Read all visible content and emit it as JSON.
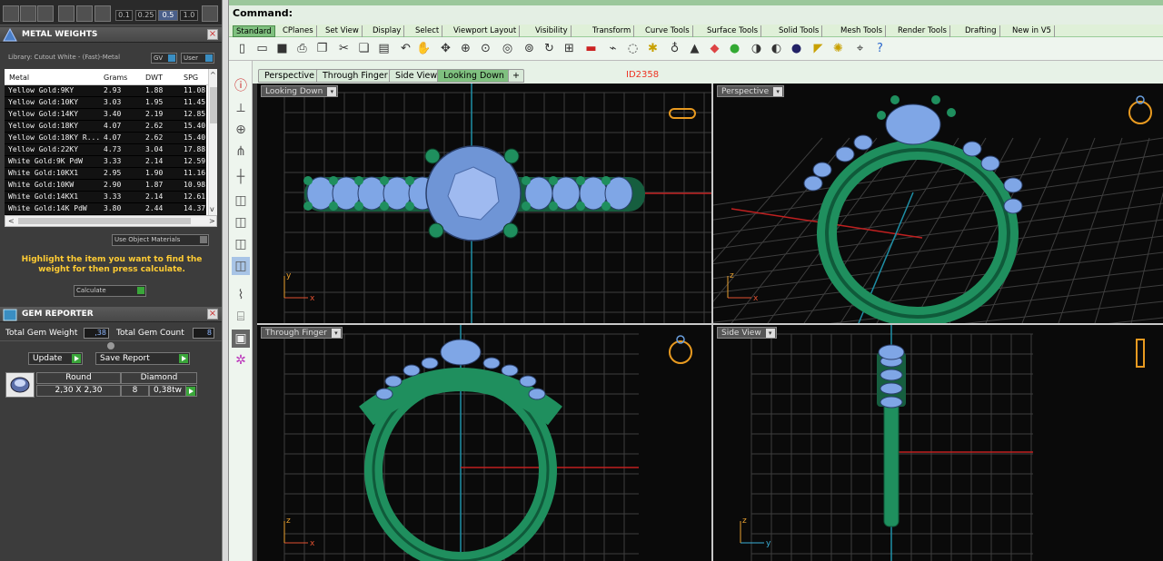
{
  "toolbar_numbers": [
    "0.1",
    "0.25",
    "0.5",
    "1.0"
  ],
  "metal_panel": {
    "title": "METAL WEIGHTS",
    "library": "Library: Cutout White - (Fast)-Metal",
    "gv_label": "GV",
    "user_label": "User",
    "columns": [
      "Metal",
      "Grams",
      "DWT",
      "SPG"
    ],
    "rows": [
      {
        "metal": "Yellow Gold:9KY",
        "grams": "2.93",
        "dwt": "1.88",
        "spg": "11.08"
      },
      {
        "metal": "Yellow Gold:10KY",
        "grams": "3.03",
        "dwt": "1.95",
        "spg": "11.45"
      },
      {
        "metal": "Yellow Gold:14KY",
        "grams": "3.40",
        "dwt": "2.19",
        "spg": "12.85"
      },
      {
        "metal": "Yellow Gold:18KY",
        "grams": "4.07",
        "dwt": "2.62",
        "spg": "15.40"
      },
      {
        "metal": "Yellow Gold:18KY R...",
        "grams": "4.07",
        "dwt": "2.62",
        "spg": "15.40"
      },
      {
        "metal": "Yellow Gold:22KY",
        "grams": "4.73",
        "dwt": "3.04",
        "spg": "17.88"
      },
      {
        "metal": "White Gold:9K PdW",
        "grams": "3.33",
        "dwt": "2.14",
        "spg": "12.59"
      },
      {
        "metal": "White Gold:10KX1",
        "grams": "2.95",
        "dwt": "1.90",
        "spg": "11.16"
      },
      {
        "metal": "White Gold:10KW",
        "grams": "2.90",
        "dwt": "1.87",
        "spg": "10.98"
      },
      {
        "metal": "White Gold:14KX1",
        "grams": "3.33",
        "dwt": "2.14",
        "spg": "12.61"
      },
      {
        "metal": "White Gold:14K PdW",
        "grams": "3.80",
        "dwt": "2.44",
        "spg": "14.37"
      }
    ],
    "use_object_materials": "Use Object Materials",
    "hint": "Highlight the item you want to find the weight for then press calculate.",
    "calculate_label": "Calculate"
  },
  "gem_panel": {
    "title": "GEM REPORTER",
    "total_weight_label": "Total Gem Weight",
    "total_weight_value": ",38",
    "total_count_label": "Total Gem Count",
    "total_count_value": "8",
    "update_label": "Update",
    "save_label": "Save Report",
    "shape_header": "Round",
    "material_header": "Diamond",
    "size_value": "2,30 X 2,30",
    "count_value": "8",
    "tw_value": "0,38tw"
  },
  "command": {
    "label": "Command:"
  },
  "tabs": [
    "Standard",
    "CPlanes",
    "Set View",
    "Display",
    "Select",
    "Viewport Layout",
    "Visibility",
    "Transform",
    "Curve Tools",
    "Surface Tools",
    "Solid Tools",
    "Mesh Tools",
    "Render Tools",
    "Drafting",
    "New in V5"
  ],
  "viewport_tabs": [
    "Perspective",
    "Through Finger",
    "Side View",
    "Looking Down"
  ],
  "viewport_id": "ID2358",
  "viewports": {
    "top_left": "Looking Down",
    "top_right": "Perspective",
    "bottom_left": "Through Finger",
    "bottom_right": "Side View"
  },
  "axis_labels": {
    "x": "x",
    "y": "y",
    "z": "z"
  },
  "colors": {
    "metal": "#1f8f5e",
    "gem": "#7fa6e6",
    "x_axis": "#c02020",
    "y_axis": "#1e8fa6",
    "tab_active": "#7fc07f"
  }
}
